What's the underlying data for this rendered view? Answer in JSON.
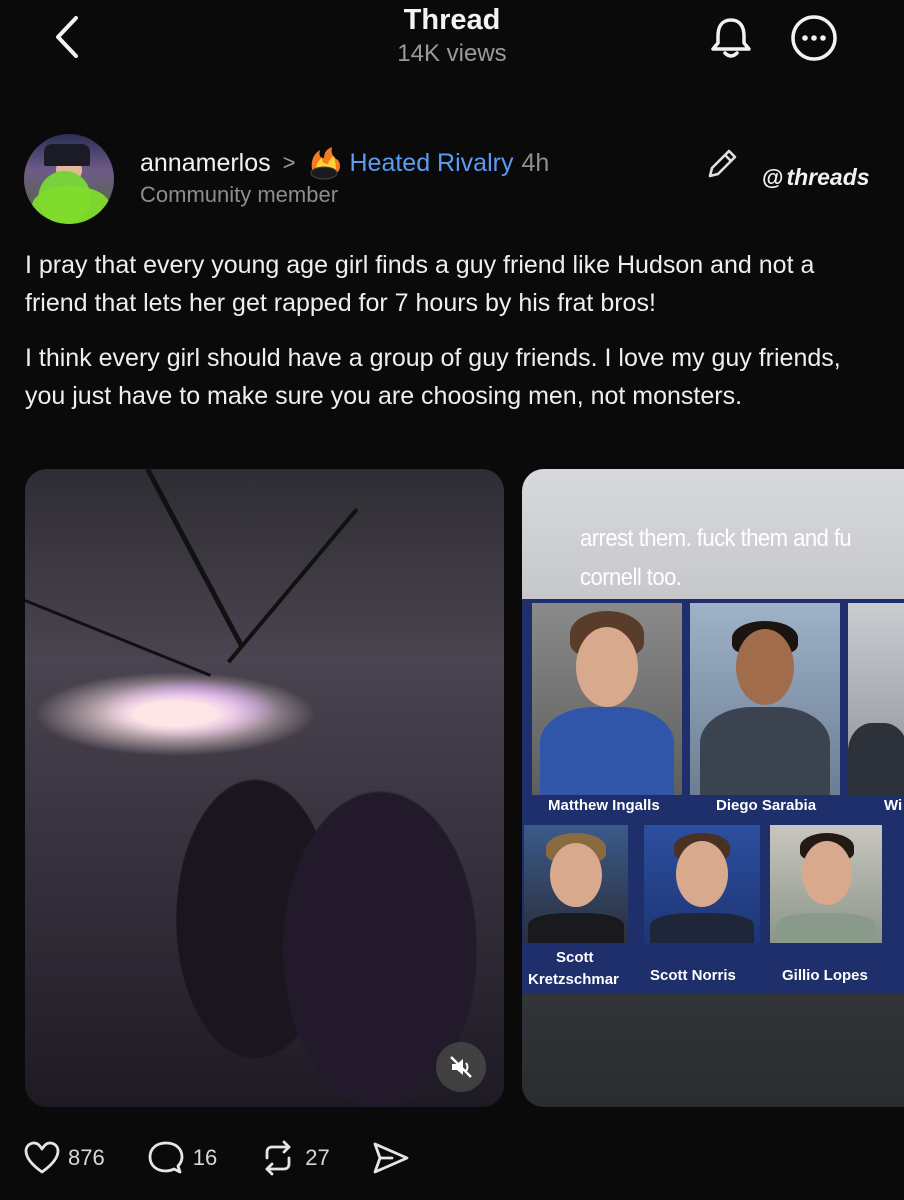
{
  "header": {
    "title": "Thread",
    "views": "14K views"
  },
  "post": {
    "username": "annamerlos",
    "community": "Heated Rivalry",
    "time": "4h",
    "role": "Community member",
    "brand": "threads",
    "paragraphs": [
      "I pray that every young age girl finds a guy friend like Hudson and not a friend that lets her get rapped for 7 hours by his frat bros!",
      "I think every girl should have a group of guy friends. I love my guy friends, you just have to make sure you are choosing men, not monsters."
    ]
  },
  "media": {
    "image2": {
      "caption_line1": "arrest them. fuck them and fu",
      "caption_line2": "cornell too.",
      "names": {
        "n1": "Matthew Ingalls",
        "n2": "Diego Sarabia",
        "n3": "Wi",
        "n4a": "Scott",
        "n4b": "Kretzschmar",
        "n5": "Scott Norris",
        "n6": "Gillio Lopes"
      }
    }
  },
  "actions": {
    "likes": "876",
    "replies": "16",
    "reposts": "27"
  },
  "icons": {
    "back": "chevron-left-icon",
    "bell": "bell-icon",
    "more": "more-icon",
    "edit": "pencil-icon",
    "like": "heart-icon",
    "reply": "comment-icon",
    "repost": "repost-icon",
    "share": "send-icon",
    "mute": "muted-speaker-icon"
  },
  "colors": {
    "background": "#0a0a0a",
    "community_link": "#5b9bf2",
    "secondary_text": "#8d8d8d"
  }
}
